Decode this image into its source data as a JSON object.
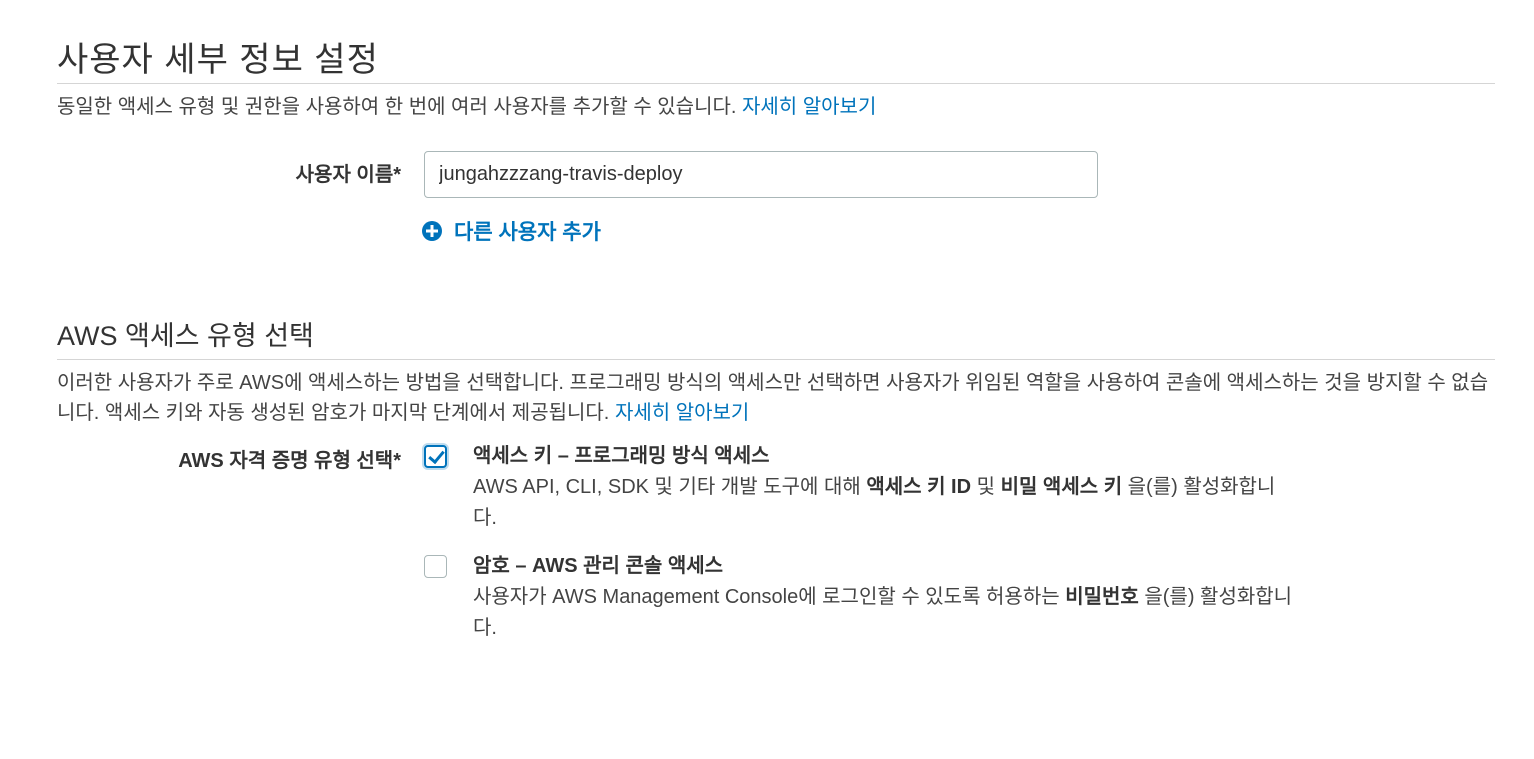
{
  "section1": {
    "title": "사용자 세부 정보 설정",
    "description": "동일한 액세스 유형 및 권한을 사용하여 한 번에 여러 사용자를 추가할 수 있습니다.",
    "learn_more": "자세히 알아보기",
    "username_label": "사용자 이름*",
    "username_value": "jungahzzzang-travis-deploy",
    "add_user_label": "다른 사용자 추가"
  },
  "section2": {
    "title": "AWS 액세스 유형 선택",
    "description": "이러한 사용자가 주로 AWS에 액세스하는 방법을 선택합니다. 프로그래밍 방식의 액세스만 선택하면 사용자가 위임된 역할을 사용하여 콘솔에 액세스하는 것을 방지할 수 없습니다. 액세스 키와 자동 생성된 암호가 마지막 단계에서 제공됩니다.",
    "learn_more": "자세히 알아보기",
    "credential_label": "AWS 자격 증명 유형 선택*",
    "options": [
      {
        "title": "액세스 키 – 프로그래밍 방식 액세스",
        "checked": true,
        "desc_before": "AWS API, CLI, SDK 및 기타 개발 도구에 대해",
        "desc_bold_1": "액세스 키 ID",
        "desc_middle": "및",
        "desc_bold_2": "비밀 액세스 키",
        "desc_after": "을(를) 활성화합니다."
      },
      {
        "title": "암호 – AWS 관리 콘솔 액세스",
        "checked": false,
        "desc_before": "사용자가 AWS Management Console에 로그인할 수 있도록 허용하는",
        "desc_bold_1": "비밀번호",
        "desc_after": "을(를) 활성화합니다."
      }
    ]
  },
  "colors": {
    "link": "#0073bb",
    "divider": "#d5d5d5",
    "text": "#444444"
  },
  "icons": {
    "add_user": "plus-circle-icon",
    "checkbox_checked": "checkmark-icon"
  }
}
